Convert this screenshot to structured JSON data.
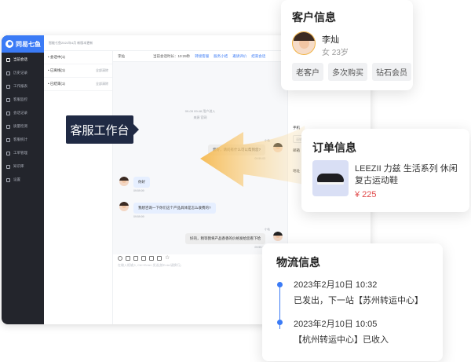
{
  "app": {
    "brand": "同易七鱼",
    "notice": "智能七鱼2021年4月 新版本更新",
    "top_options": [
      "地址",
      "帮助",
      "下载中心"
    ],
    "sidebar": [
      {
        "label": "当前会话",
        "icon": "chat-icon",
        "active": true
      },
      {
        "label": "历史记录",
        "icon": "history-icon"
      },
      {
        "label": "工作报表",
        "icon": "report-icon"
      },
      {
        "label": "客服监控",
        "icon": "monitor-icon"
      },
      {
        "label": "会话记录",
        "icon": "record-icon"
      },
      {
        "label": "质量检测",
        "icon": "quality-icon"
      },
      {
        "label": "客服统计",
        "icon": "stats-icon"
      },
      {
        "label": "工单管理",
        "icon": "ticket-icon"
      },
      {
        "label": "知识库",
        "icon": "book-icon"
      },
      {
        "label": "设置",
        "icon": "gear-icon"
      }
    ],
    "conversations": [
      {
        "label": "• 会话中(1)",
        "action": ""
      },
      {
        "label": "• 已离线(1)",
        "action": "全部清除"
      },
      {
        "label": "• 已结束(1)",
        "action": "全部清除"
      }
    ],
    "chat": {
      "header_name": "李灿",
      "header_status": "当前会话时长：10:29秒",
      "header_links": [
        "转接客服",
        "服务小结",
        "邀请评价",
        "结束会话"
      ],
      "system_line1": "09-05 09:48 用户进入",
      "system_line2": "来源 官网",
      "messages": [
        {
          "dir": "out",
          "text": "您好，请问有什么可以帮到您?",
          "sender": "小仙",
          "time": "09:59:03"
        },
        {
          "dir": "in",
          "text": "你好",
          "time": "09:59:09"
        },
        {
          "dir": "in",
          "text": "我想咨询一下你们这个产品具体是怎么收费的?",
          "time": "09:59:09"
        },
        {
          "dir": "out",
          "text": "好的，稍等我将产品香香的价格发给您看下哈",
          "sender": "小仙",
          "time": "09:59:10"
        }
      ],
      "input_placeholder": "在输入框输入 Ctrl+Enter 发送(按Enter键换行)",
      "send_label": "发送"
    },
    "right_panel": {
      "fields": [
        {
          "label": "手机",
          "placeholder": "请输入"
        },
        {
          "label": "邮箱",
          "placeholder": ""
        },
        {
          "label": "地址",
          "placeholder": ""
        }
      ]
    }
  },
  "callout": {
    "label": "客服工作台"
  },
  "customer_card": {
    "title": "客户信息",
    "name": "李灿",
    "gender_age": "女  23岁",
    "tags": [
      "老客户",
      "多次购买",
      "钻石会员"
    ]
  },
  "order_card": {
    "title": "订单信息",
    "product_name": "LEEZII 力兹 生活系列 休闲复古运动鞋",
    "price": "¥ 225"
  },
  "logistics_card": {
    "title": "物流信息",
    "events": [
      {
        "time": "2023年2月10日  10:32",
        "desc": "已发出，下一站【苏州转运中心】"
      },
      {
        "time": "2023年2月10日  10:05",
        "desc": "【杭州转运中心】已收入"
      }
    ]
  },
  "colors": {
    "accent": "#3b7bf6",
    "sidebar_bg": "#23252c",
    "callout_bg": "#202a44",
    "price": "#e04848",
    "arrow": "#f6c56b"
  }
}
